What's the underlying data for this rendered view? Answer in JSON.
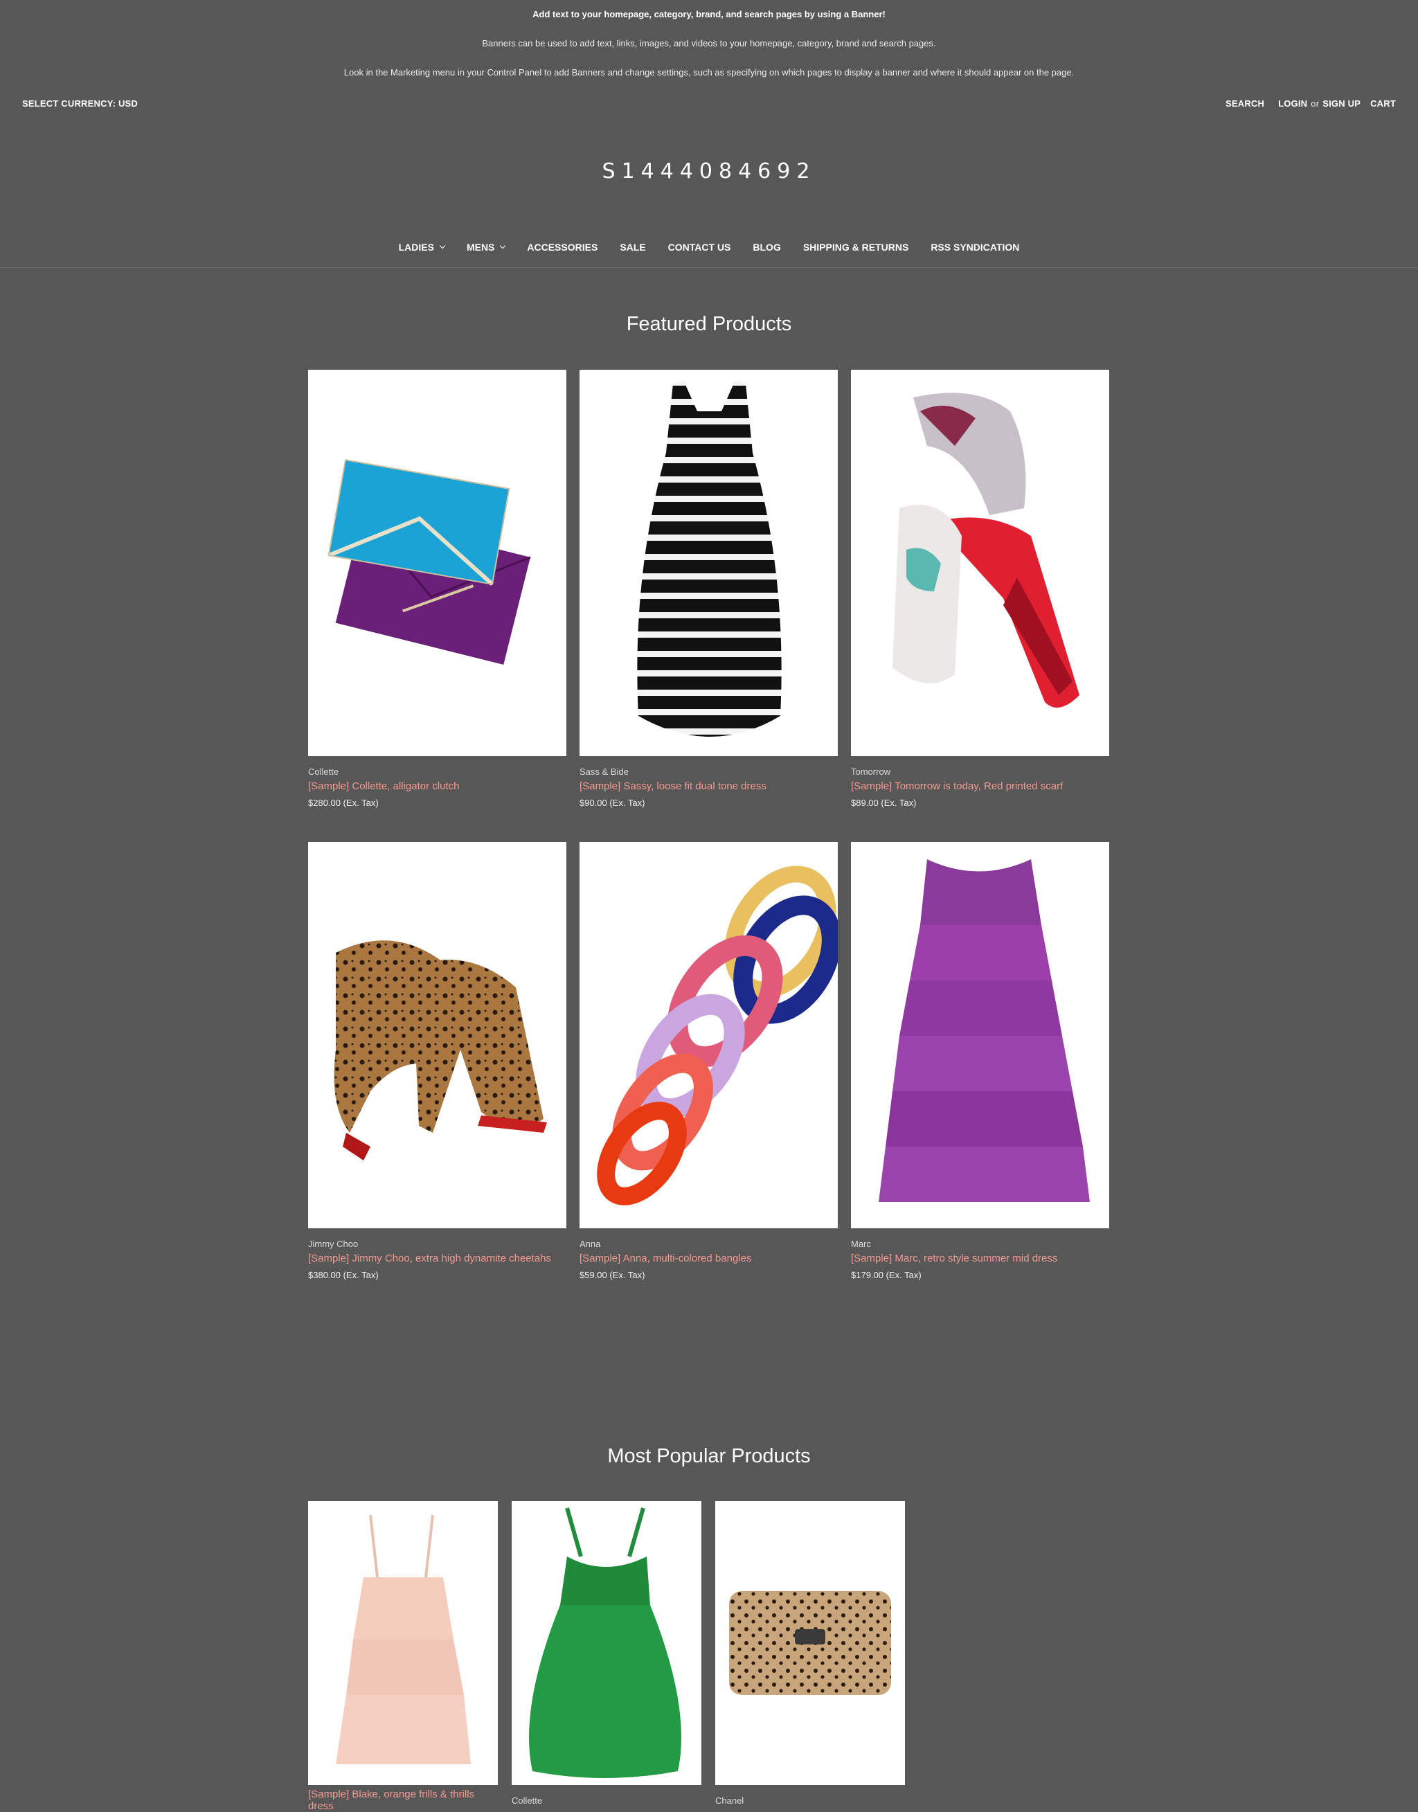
{
  "banner": {
    "line1": "Add text to your homepage, category, brand, and search pages by using a Banner!",
    "line2": "Banners can be used to add text, links, images, and videos to your homepage, category, brand and search pages.",
    "line3": "Look in the Marketing menu in your Control Panel to add Banners and change settings, such as specifying on which pages to display a banner and where it should appear on the page."
  },
  "topbar": {
    "currency": "SELECT CURRENCY: USD",
    "search": "SEARCH",
    "login": "LOGIN",
    "or": "or",
    "signup": "SIGN UP",
    "cart": "CART"
  },
  "store_name": "S1444084692",
  "nav": {
    "ladies": "LADIES",
    "mens": "MENS",
    "accessories": "ACCESSORIES",
    "sale": "SALE",
    "contact": "CONTACT US",
    "blog": "BLOG",
    "shipping": "SHIPPING & RETURNS",
    "rss": "RSS SYNDICATION"
  },
  "featured": {
    "title": "Featured Products",
    "products": [
      {
        "brand": "Collette",
        "name": "[Sample] Collette, alligator clutch",
        "price": "$280.00 (Ex. Tax)",
        "image": "clutch"
      },
      {
        "brand": "Sass & Bide",
        "name": "[Sample] Sassy, loose fit dual tone dress",
        "price": "$90.00 (Ex. Tax)",
        "image": "striped-dress"
      },
      {
        "brand": "Tomorrow",
        "name": "[Sample] Tomorrow is today, Red printed scarf",
        "price": "$89.00 (Ex. Tax)",
        "image": "scarf"
      },
      {
        "brand": "Jimmy Choo",
        "name": "[Sample] Jimmy Choo, extra high dynamite cheetahs",
        "price": "$380.00 (Ex. Tax)",
        "image": "leopard-heels"
      },
      {
        "brand": "Anna",
        "name": "[Sample] Anna, multi-colored bangles",
        "price": "$59.00 (Ex. Tax)",
        "image": "bangles"
      },
      {
        "brand": "Marc",
        "name": "[Sample] Marc, retro style summer mid dress",
        "price": "$179.00 (Ex. Tax)",
        "image": "purple-dress"
      }
    ]
  },
  "popular": {
    "title": "Most Popular Products",
    "products": [
      {
        "name": "[Sample] Blake, orange frills & thrills dress",
        "image": "peach-dress"
      },
      {
        "brand": "Collette",
        "image": "green-dress"
      },
      {
        "brand": "Chanel",
        "image": "leopard-clutch"
      }
    ]
  },
  "colors": {
    "background": "#575757",
    "product_link": "#f39a91"
  }
}
